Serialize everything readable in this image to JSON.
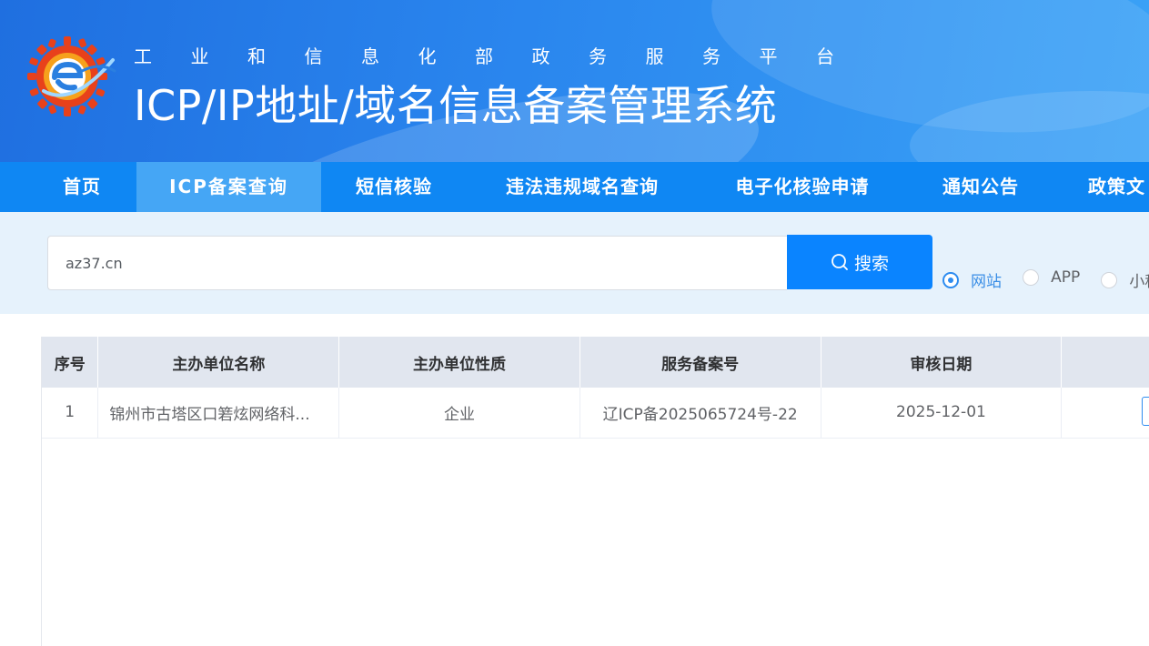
{
  "header": {
    "subtitle": "工业和信息化部政务服务平台",
    "title": "ICP/IP地址/域名信息备案管理系统"
  },
  "nav": {
    "items": [
      {
        "label": "首页"
      },
      {
        "label": "ICP备案查询",
        "active": true
      },
      {
        "label": "短信核验"
      },
      {
        "label": "违法违规域名查询"
      },
      {
        "label": "电子化核验申请"
      },
      {
        "label": "通知公告"
      },
      {
        "label": "政策文"
      }
    ]
  },
  "search": {
    "value": "az37.cn",
    "button_label": "搜索",
    "options": [
      {
        "label": "网站",
        "checked": true
      },
      {
        "label": "APP",
        "checked": false
      },
      {
        "label": "小程",
        "checked": false
      }
    ]
  },
  "table": {
    "columns": [
      "序号",
      "主办单位名称",
      "主办单位性质",
      "服务备案号",
      "审核日期",
      ""
    ],
    "rows": [
      {
        "index": "1",
        "org_name": "锦州市古塔区口箬炫网络科...",
        "org_type": "企业",
        "record_no": "辽ICP备2025065724号-22",
        "date": "2025-12-01"
      }
    ]
  },
  "colors": {
    "nav_bg": "#0f87f3",
    "nav_active_bg": "#45a6f5",
    "search_button": "#0a84ff",
    "search_area_bg": "#e6f2fc",
    "table_header_bg": "#e1e6ef",
    "radio_checked": "#2d8cf0"
  }
}
